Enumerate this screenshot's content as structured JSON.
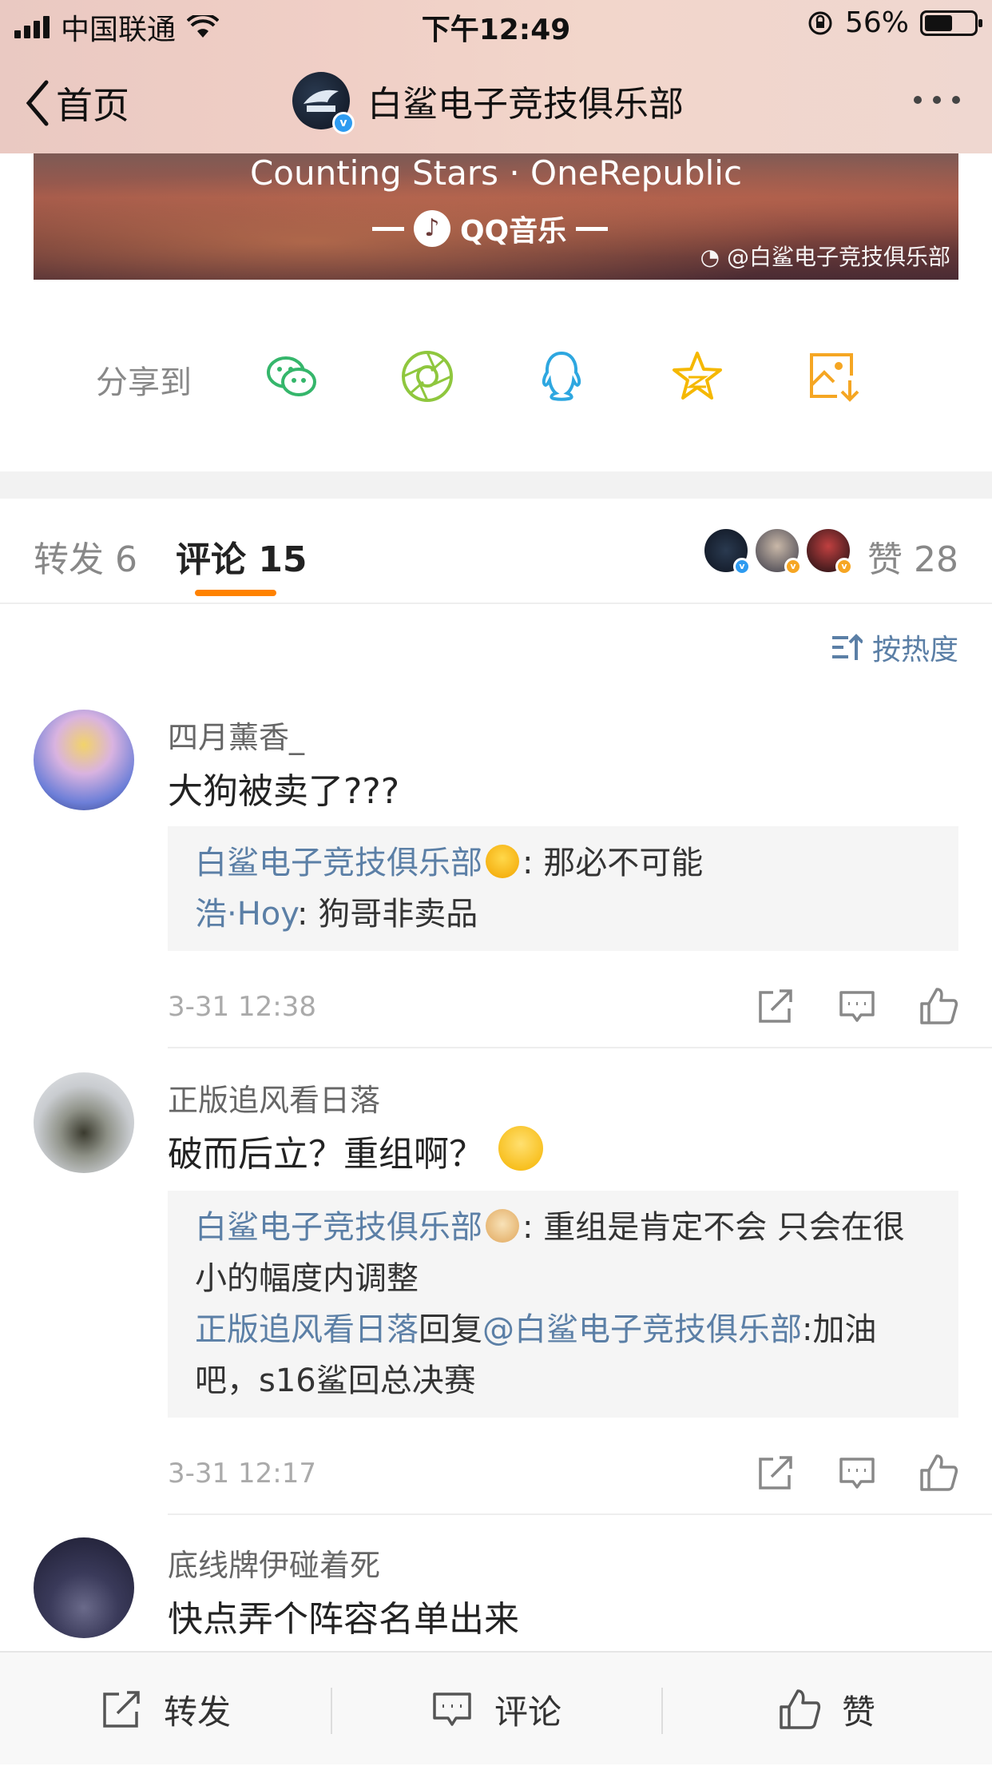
{
  "statusbar": {
    "carrier": "中国联通",
    "time": "下午12:49",
    "battery": "56%",
    "battery_level": 0.56
  },
  "nav": {
    "back_label": "首页",
    "title": "白鲨电子竞技俱乐部"
  },
  "banner": {
    "song": "Counting Stars · OneRepublic",
    "music_app": "QQ音乐",
    "watermark": "@白鲨电子竞技俱乐部"
  },
  "share": {
    "label": "分享到",
    "icons": [
      "wechat-icon",
      "moments-icon",
      "qq-icon",
      "qzone-icon",
      "save-image-icon"
    ]
  },
  "tabs": {
    "repost": "转发 6",
    "comment": "评论 15",
    "like": "赞 28"
  },
  "sort_label": "按热度",
  "comments": [
    {
      "user": "四月薰香_",
      "text": "大狗被卖了???",
      "replies": [
        {
          "name": "白鲨电子竞技俱乐部",
          "text": ": 那必不可能"
        },
        {
          "name": "浩·Hoy",
          "text": ": 狗哥非卖品"
        }
      ],
      "time": "3-31 12:38"
    },
    {
      "user": "正版追风看日落",
      "text": "破而后立？重组啊？",
      "replies": [
        {
          "name": "白鲨电子竞技俱乐部",
          "text": ": 重组是肯定不会 只会在很小的幅度内调整"
        },
        {
          "name": "正版追风看日落",
          "mid": "回复",
          "mention": "@白鲨电子竞技俱乐部",
          "text": ":加油吧，s16鲨回总决赛"
        }
      ],
      "time": "3-31 12:17"
    },
    {
      "user": "底线牌伊碰着死",
      "text": "快点弄个阵容名单出来"
    }
  ],
  "bottombar": {
    "repost": "转发",
    "comment": "评论",
    "like": "赞"
  },
  "colors": {
    "accent": "#ff8200",
    "link": "#5b7fa6",
    "verified": "#2e9bf0"
  }
}
